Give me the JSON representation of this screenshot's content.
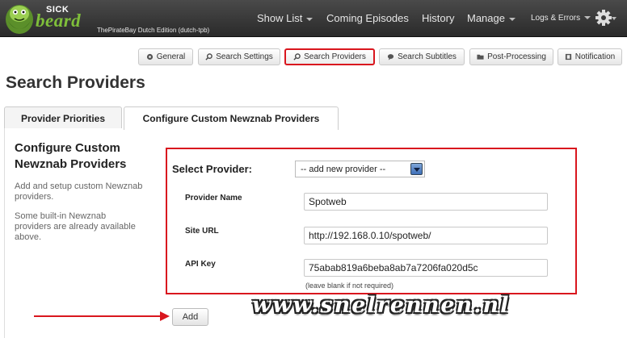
{
  "app": {
    "logo_small": "SICK",
    "logo_word": "beard",
    "subtitle": "ThePirateBay Dutch Edition (dutch-tpb)"
  },
  "nav": {
    "items": [
      {
        "label": "Show List",
        "dropdown": true
      },
      {
        "label": "Coming Episodes",
        "dropdown": false
      },
      {
        "label": "History",
        "dropdown": false
      },
      {
        "label": "Manage",
        "dropdown": true
      },
      {
        "label": "Logs & Errors",
        "dropdown": true
      }
    ],
    "settings_icon": "gear-icon"
  },
  "config_tabs": [
    {
      "label": "General",
      "icon": "gear-icon"
    },
    {
      "label": "Search Settings",
      "icon": "search-icon"
    },
    {
      "label": "Search Providers",
      "icon": "search-icon",
      "active": true
    },
    {
      "label": "Search Subtitles",
      "icon": "speech-bubble-icon"
    },
    {
      "label": "Post-Processing",
      "icon": "folder-icon"
    },
    {
      "label": "Notification",
      "icon": "notification-icon"
    }
  ],
  "page": {
    "title": "Search Providers"
  },
  "tabs": [
    {
      "label": "Provider Priorities",
      "active": false
    },
    {
      "label": "Configure Custom Newznab Providers",
      "active": true
    }
  ],
  "section": {
    "title": "Configure Custom Newznab Providers",
    "desc1": "Add and setup custom Newznab providers.",
    "desc2": "Some built-in Newznab providers are already available above."
  },
  "form": {
    "select_label": "Select Provider:",
    "select_value": "-- add new provider --",
    "name_label": "Provider Name",
    "name_value": "Spotweb",
    "url_label": "Site URL",
    "url_value": "http://192.168.0.10/spotweb/",
    "key_label": "API Key",
    "key_value": "75abab819a6beba8ab7a7206fa020d5c",
    "key_hint": "(leave blank if not required)",
    "add_label": "Add"
  },
  "watermark": "www.snelrennen.nl",
  "colors": {
    "highlight": "#d9161e",
    "navbar": "#333333",
    "logo_green": "#7fbf3a"
  }
}
